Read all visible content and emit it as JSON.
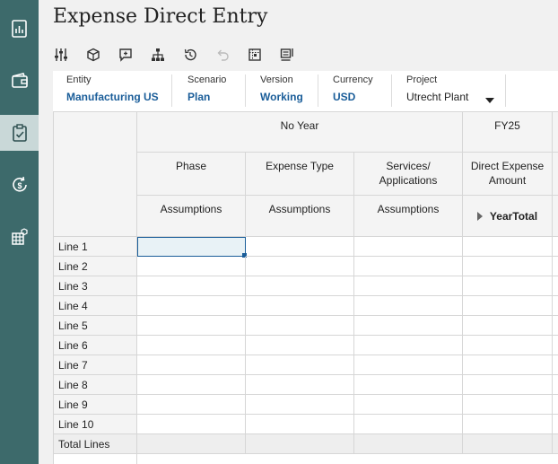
{
  "page": {
    "title": "Expense Direct Entry"
  },
  "nav": {
    "items": [
      {
        "icon": "chart-report-icon",
        "active": false
      },
      {
        "icon": "wallet-icon",
        "active": false
      },
      {
        "icon": "clipboard-check-icon",
        "active": true
      },
      {
        "icon": "currency-refresh-icon",
        "active": false
      },
      {
        "icon": "grid-settings-icon",
        "active": false
      }
    ]
  },
  "toolbar": {
    "buttons": [
      {
        "icon": "sliders-icon"
      },
      {
        "icon": "cube-icon"
      },
      {
        "icon": "comment-add-icon"
      },
      {
        "icon": "hierarchy-icon"
      },
      {
        "icon": "history-icon"
      },
      {
        "icon": "undo-icon"
      },
      {
        "icon": "grid-frame-icon"
      },
      {
        "icon": "form-layout-icon"
      }
    ]
  },
  "pov": {
    "entity": {
      "label": "Entity",
      "value": "Manufacturing US"
    },
    "scenario": {
      "label": "Scenario",
      "value": "Plan"
    },
    "version": {
      "label": "Version",
      "value": "Working"
    },
    "currency": {
      "label": "Currency",
      "value": "USD"
    },
    "project": {
      "label": "Project",
      "value": "Utrecht Plant"
    }
  },
  "grid": {
    "year_headers": {
      "no_year": "No Year",
      "fy": "FY25"
    },
    "columns": [
      {
        "label": "Phase",
        "sub": "Assumptions"
      },
      {
        "label": "Expense Type",
        "sub": "Assumptions"
      },
      {
        "label": "Services/\nApplications",
        "sub": "Assumptions"
      },
      {
        "label": "Direct Expense\nAmount",
        "sub": "YearTotal"
      }
    ],
    "rows": [
      "Line 1",
      "Line 2",
      "Line 3",
      "Line 4",
      "Line 5",
      "Line 6",
      "Line 7",
      "Line 8",
      "Line 9",
      "Line 10"
    ],
    "total_row": "Total Lines"
  }
}
